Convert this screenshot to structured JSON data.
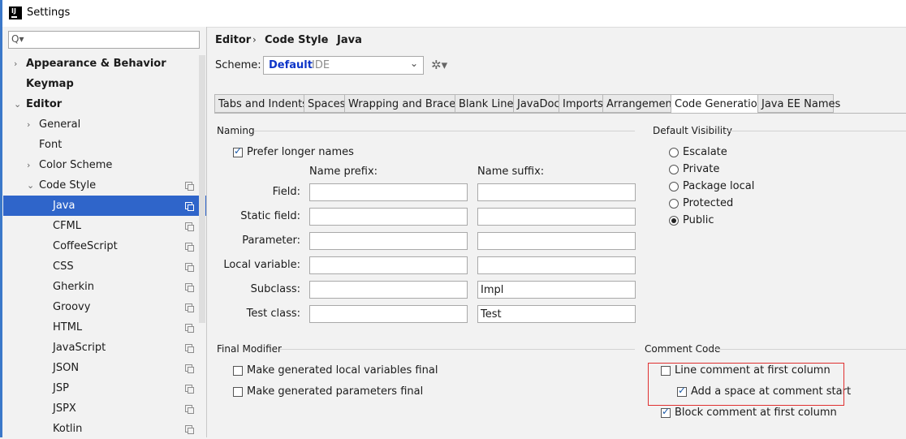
{
  "window": {
    "title": "Settings",
    "icon_text": "IJ"
  },
  "search": {
    "glyph": "Q▾",
    "value": ""
  },
  "tree": [
    {
      "label": "Appearance & Behavior",
      "arrow": "›",
      "bold": true
    },
    {
      "label": "Keymap",
      "arrow": "",
      "bold": true
    },
    {
      "label": "Editor",
      "arrow": "⌄",
      "bold": true
    },
    {
      "label": "General",
      "arrow": "›"
    },
    {
      "label": "Font",
      "arrow": ""
    },
    {
      "label": "Color Scheme",
      "arrow": "›"
    },
    {
      "label": "Code Style",
      "arrow": "⌄",
      "copy": true
    },
    {
      "label": "Java",
      "arrow": "",
      "copy": true,
      "selected": true
    },
    {
      "label": "CFML",
      "arrow": "",
      "copy": true
    },
    {
      "label": "CoffeeScript",
      "arrow": "",
      "copy": true
    },
    {
      "label": "CSS",
      "arrow": "",
      "copy": true
    },
    {
      "label": "Gherkin",
      "arrow": "",
      "copy": true
    },
    {
      "label": "Groovy",
      "arrow": "",
      "copy": true
    },
    {
      "label": "HTML",
      "arrow": "",
      "copy": true
    },
    {
      "label": "JavaScript",
      "arrow": "",
      "copy": true
    },
    {
      "label": "JSON",
      "arrow": "",
      "copy": true
    },
    {
      "label": "JSP",
      "arrow": "",
      "copy": true
    },
    {
      "label": "JSPX",
      "arrow": "",
      "copy": true
    },
    {
      "label": "Kotlin",
      "arrow": "",
      "copy": true
    }
  ],
  "breadcrumb": {
    "items": [
      "Editor",
      "Code Style",
      "Java"
    ],
    "separator": "›"
  },
  "scheme": {
    "label": "Scheme:",
    "name": "Default",
    "tag": "IDE",
    "chevron": "⌄",
    "gear": "✲▾"
  },
  "tabs": [
    "Tabs and Indents",
    "Spaces",
    "Wrapping and Braces",
    "Blank Lines",
    "JavaDoc",
    "Imports",
    "Arrangement",
    "Code Generation",
    "Java EE Names"
  ],
  "active_tab": "Code Generation",
  "naming": {
    "title": "Naming",
    "prefer_longer": {
      "label": "Prefer longer names",
      "checked": true
    },
    "prefix_header": "Name prefix:",
    "suffix_header": "Name suffix:",
    "rows": [
      {
        "label": "Field:",
        "prefix": "",
        "suffix": ""
      },
      {
        "label": "Static field:",
        "prefix": "",
        "suffix": ""
      },
      {
        "label": "Parameter:",
        "prefix": "",
        "suffix": ""
      },
      {
        "label": "Local variable:",
        "prefix": "",
        "suffix": ""
      },
      {
        "label": "Subclass:",
        "prefix": "",
        "suffix": "Impl"
      },
      {
        "label": "Test class:",
        "prefix": "",
        "suffix": "Test"
      }
    ]
  },
  "visibility": {
    "title": "Default Visibility",
    "options": [
      {
        "label": "Escalate",
        "checked": false
      },
      {
        "label": "Private",
        "checked": false
      },
      {
        "label": "Package local",
        "checked": false
      },
      {
        "label": "Protected",
        "checked": false
      },
      {
        "label": "Public",
        "checked": true
      }
    ]
  },
  "final_modifier": {
    "title": "Final Modifier",
    "options": [
      {
        "label": "Make generated local variables final",
        "checked": false
      },
      {
        "label": "Make generated parameters final",
        "checked": false
      }
    ]
  },
  "comment_code": {
    "title": "Comment Code",
    "options": [
      {
        "label": "Line comment at first column",
        "checked": false
      },
      {
        "label": "Add a space at comment start",
        "checked": true
      },
      {
        "label": "Block comment at first column",
        "checked": true
      }
    ]
  },
  "colors": {
    "selection": "#2f65ca",
    "scheme_name": "#0d35c8",
    "highlight_box": "#e03030"
  }
}
